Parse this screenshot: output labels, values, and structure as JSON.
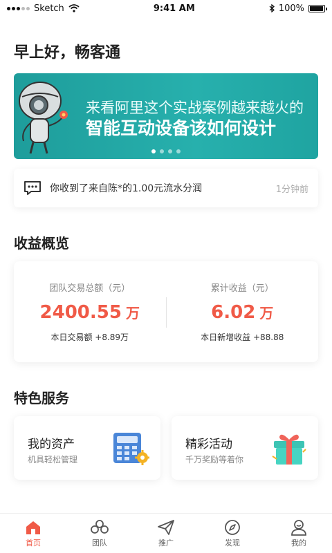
{
  "status_bar": {
    "carrier": "Sketch",
    "time": "9:41 AM",
    "battery": "100%",
    "battery_level": 1.0
  },
  "greeting": "早上好，畅客通",
  "banner": {
    "line1": "来看阿里这个实战案例越来越火的",
    "line2": "智能互动设备该如何设计",
    "slide_count": 4,
    "active_slide": 1
  },
  "notice": {
    "text": "你收到了来自陈*的1.00元流水分润",
    "time": "1分钟前"
  },
  "earnings": {
    "section_title": "收益概览",
    "left": {
      "label": "团队交易总额（元）",
      "value": "2400.55",
      "unit": "万",
      "sub": "本日交易额 +8.89万"
    },
    "right": {
      "label": "累计收益（元）",
      "value": "6.02",
      "unit": "万",
      "sub": "本日新增收益 +88.88"
    }
  },
  "services": {
    "section_title": "特色服务",
    "items": [
      {
        "title": "我的资产",
        "subtitle": "机具轻松管理",
        "icon": "calculator-icon"
      },
      {
        "title": "精彩活动",
        "subtitle": "千万奖励等着你",
        "icon": "gift-icon"
      }
    ]
  },
  "tabbar": {
    "items": [
      {
        "label": "首页",
        "icon": "home-icon",
        "active": true
      },
      {
        "label": "团队",
        "icon": "team-icon",
        "active": false
      },
      {
        "label": "推广",
        "icon": "send-icon",
        "active": false
      },
      {
        "label": "发现",
        "icon": "compass-icon",
        "active": false
      },
      {
        "label": "我的",
        "icon": "profile-icon",
        "active": false
      }
    ]
  },
  "colors": {
    "accent": "#f05a47",
    "banner_teal": "#23a8a5",
    "text_primary": "#222222",
    "text_secondary": "#888888"
  }
}
